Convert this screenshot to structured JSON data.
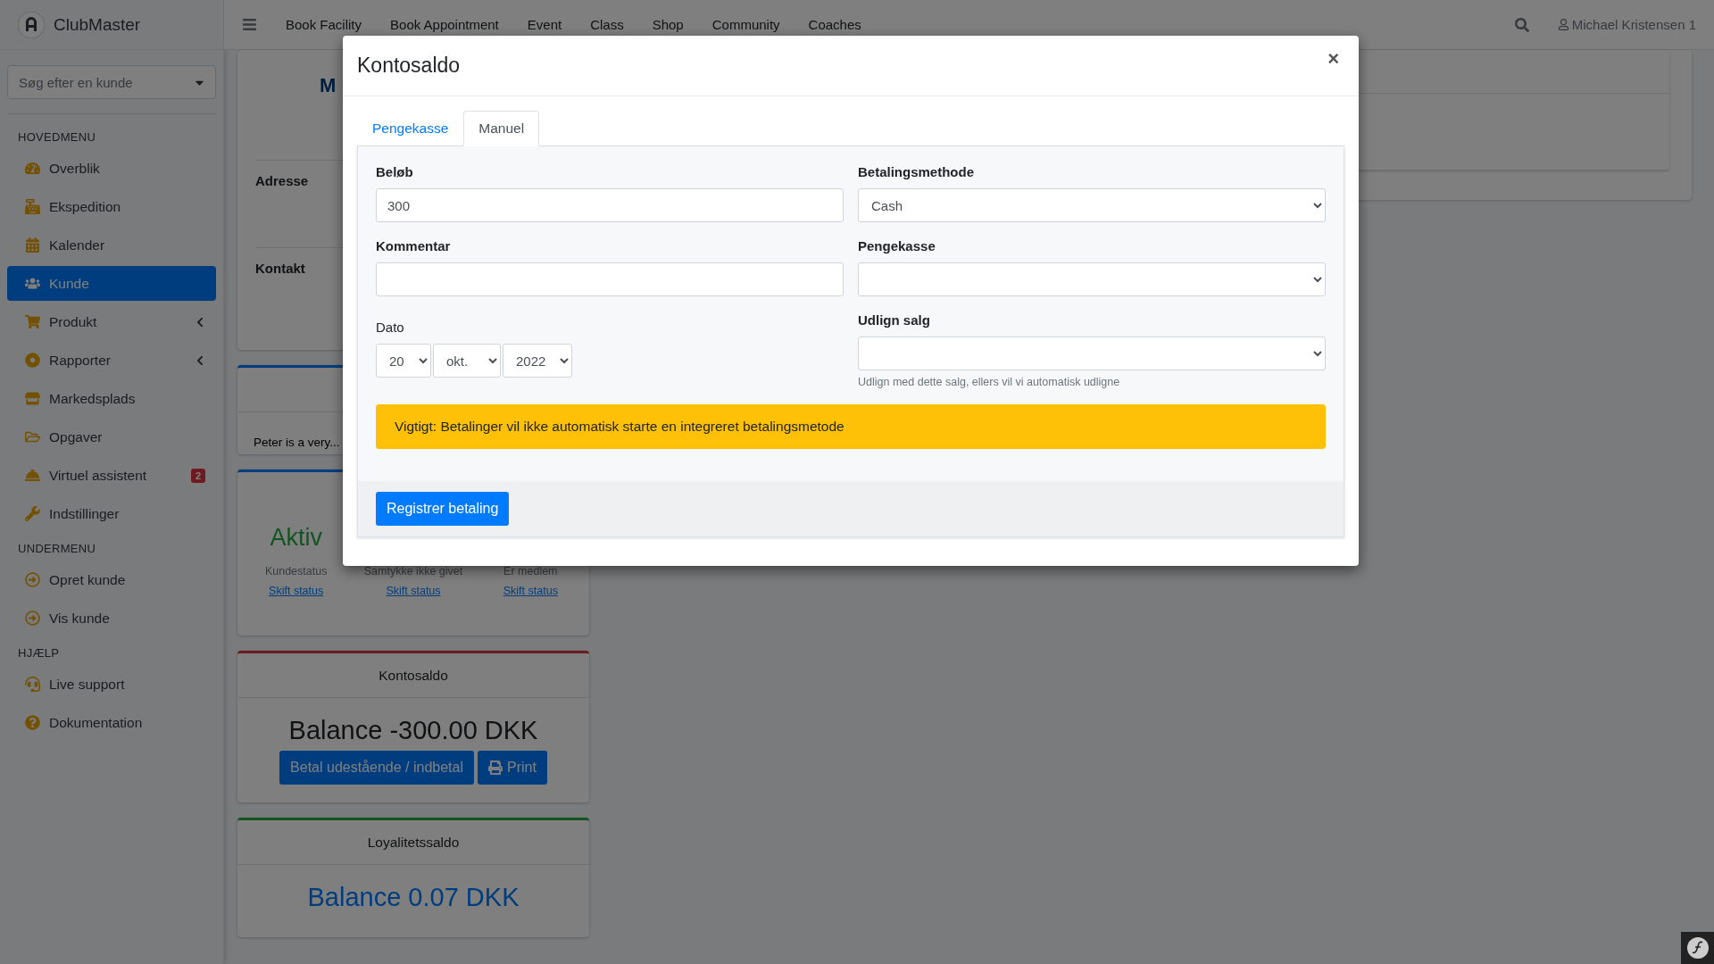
{
  "brand": {
    "name": "ClubMaster"
  },
  "customer_search": {
    "placeholder": "Søg efter en kunde"
  },
  "sidebar": {
    "sections": [
      {
        "title": "HOVEDMENU",
        "items": [
          {
            "label": "Overblik",
            "selected": false,
            "submenu": false
          },
          {
            "label": "Ekspedition",
            "selected": false,
            "submenu": false
          },
          {
            "label": "Kalender",
            "selected": false,
            "submenu": false
          },
          {
            "label": "Kunde",
            "selected": true,
            "submenu": false
          },
          {
            "label": "Produkt",
            "selected": false,
            "submenu": true
          },
          {
            "label": "Rapporter",
            "selected": false,
            "submenu": true
          },
          {
            "label": "Markedsplads",
            "selected": false,
            "submenu": false
          },
          {
            "label": "Opgaver",
            "selected": false,
            "submenu": false
          },
          {
            "label": "Virtuel assistent",
            "selected": false,
            "submenu": false,
            "badge": "2"
          },
          {
            "label": "Indstillinger",
            "selected": false,
            "submenu": false
          }
        ]
      },
      {
        "title": "UNDERMENU",
        "items": [
          {
            "label": "Opret kunde",
            "selected": false,
            "submenu": false
          },
          {
            "label": "Vis kunde",
            "selected": false,
            "submenu": false
          }
        ]
      },
      {
        "title": "HJÆLP",
        "items": [
          {
            "label": "Live support",
            "selected": false,
            "submenu": false
          },
          {
            "label": "Dokumentation",
            "selected": false,
            "submenu": false
          }
        ]
      }
    ]
  },
  "top_nav": {
    "links": [
      "Book Facility",
      "Book Appointment",
      "Event",
      "Class",
      "Shop",
      "Community",
      "Coaches"
    ],
    "user": "Michael Kristensen 1"
  },
  "customer_card": {
    "name_visible": "M",
    "rows": [
      "Adresse",
      "Kontakt"
    ]
  },
  "note_card": {
    "text": "Peter is a very..."
  },
  "status_card": {
    "statuses": [
      {
        "value": "Aktiv",
        "label": "Kundestatus",
        "link": "Skift status"
      },
      {
        "label": "Samtykke ikke givet",
        "link": "Skift status"
      },
      {
        "label": "Er medlem",
        "link": "Skift status"
      }
    ]
  },
  "balance_card": {
    "title": "Kontosaldo",
    "balance": "Balance -300.00 DKK",
    "buttons": [
      "Betal udestående / indbetal",
      "Print"
    ]
  },
  "loyalty_card": {
    "title": "Loyalitetssaldo",
    "balance": "Balance 0.07 DKK"
  },
  "modal": {
    "title": "Kontosaldo",
    "close": "×",
    "tabs": [
      {
        "label": "Pengekasse",
        "selected": false
      },
      {
        "label": "Manuel",
        "selected": true
      }
    ],
    "amount": {
      "label": "Beløb",
      "value": "300"
    },
    "payment_method": {
      "label": "Betalingsmethode",
      "value": "Cash"
    },
    "comment": {
      "label": "Kommentar"
    },
    "cash_register": {
      "label": "Pengekasse"
    },
    "date": {
      "label": "Dato",
      "day": "20",
      "month": "okt.",
      "year": "2022"
    },
    "settle_sale": {
      "label": "Udlign salg",
      "help": "Udlign med dette salg, ellers vil vi automatisk udligne"
    },
    "warning": "Vigtigt: Betalinger vil ikke automatisk starte en integreret betalingsmetode",
    "submit": "Registrer betaling"
  }
}
